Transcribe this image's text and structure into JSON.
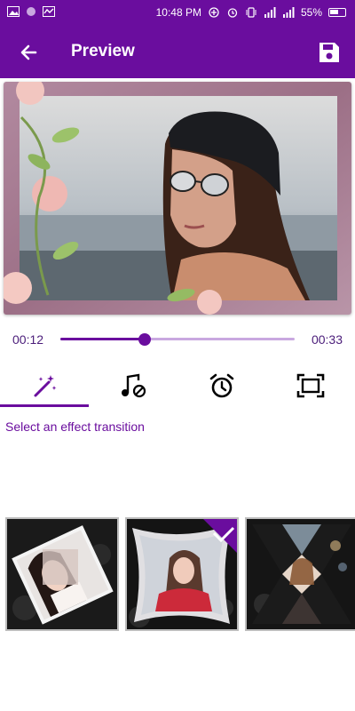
{
  "status_bar": {
    "time": "10:48 PM",
    "battery": "55%",
    "left_icons": [
      "gallery-icon",
      "circle-icon",
      "activity-icon"
    ],
    "right_icons": [
      "data-saver-icon",
      "alarm-icon",
      "vibrate-icon",
      "signal-icon",
      "signal-icon",
      "battery-icon"
    ]
  },
  "app_bar": {
    "title": "Preview",
    "back_icon": "arrow-left-icon",
    "save_icon": "save-icon"
  },
  "player": {
    "current_time": "00:12",
    "total_time": "00:33",
    "progress": 0.36
  },
  "tabs": [
    {
      "name": "effect",
      "icon": "magic-wand-icon",
      "selected": true
    },
    {
      "name": "music",
      "icon": "music-off-icon",
      "selected": false
    },
    {
      "name": "duration",
      "icon": "alarm-clock-icon",
      "selected": false
    },
    {
      "name": "frame",
      "icon": "frame-icon",
      "selected": false
    }
  ],
  "effect_hint": "Select an effect transition",
  "transitions": [
    {
      "name": "rotate-tiles",
      "selected": false
    },
    {
      "name": "curl-warp",
      "selected": true
    },
    {
      "name": "cross-cut",
      "selected": false
    }
  ],
  "colors": {
    "primary": "#6a0d9e",
    "track": "#c9a8e0",
    "text_accent": "#4b1d7a"
  }
}
